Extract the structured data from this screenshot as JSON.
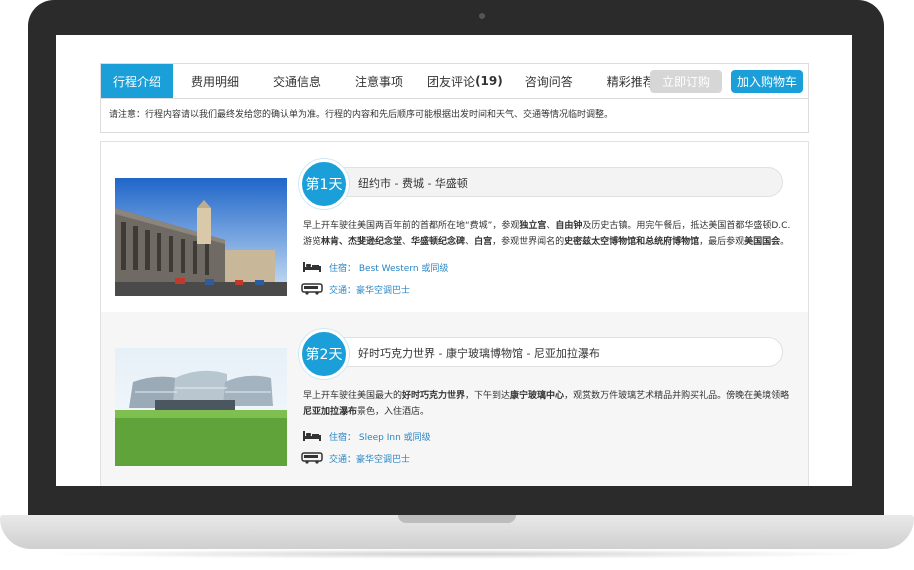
{
  "tabs": [
    {
      "label": "行程介绍"
    },
    {
      "label": "费用明细"
    },
    {
      "label": "交通信息"
    },
    {
      "label": "注意事项"
    },
    {
      "label": "团友评论",
      "count": "(19)"
    },
    {
      "label": "咨询问答"
    },
    {
      "label": "精彩推荐"
    }
  ],
  "buttons": {
    "order": "立即订购",
    "cart": "加入购物车"
  },
  "notice": "请注意：行程内容请以我们最终发给您的确认单为准。行程的内容和先后顺序可能根据出发时间和天气、交通等情况临时调整。",
  "days": [
    {
      "badge": "第1天",
      "route": "纽约市 - 费城 - 华盛顿",
      "desc_parts": [
        {
          "t": "早上开车驶往美国两百年前的首都所在地“费城”，参观",
          "b": false
        },
        {
          "t": "独立宫",
          "b": true
        },
        {
          "t": "、",
          "b": false
        },
        {
          "t": "自由钟",
          "b": true
        },
        {
          "t": "及历史古镇。用完午餐后，抵达美国首都华盛顿D.C.游览",
          "b": false
        },
        {
          "t": "林肯、杰斐逊纪念堂",
          "b": true
        },
        {
          "t": "、",
          "b": false
        },
        {
          "t": "华盛顿纪念碑",
          "b": true
        },
        {
          "t": "、",
          "b": false
        },
        {
          "t": "白宫",
          "b": true
        },
        {
          "t": "，参观世界闻名的",
          "b": false
        },
        {
          "t": "史密兹太空博物馆和总统府博物馆",
          "b": true
        },
        {
          "t": "，最后参观",
          "b": false
        },
        {
          "t": "美国国会",
          "b": true
        },
        {
          "t": "。",
          "b": false
        }
      ],
      "hotel": "住宿： Best Western 或同级",
      "transport": "交通：豪华空调巴士"
    },
    {
      "badge": "第2天",
      "route": "好时巧克力世界 - 康宁玻璃博物馆 - 尼亚加拉瀑布",
      "desc_parts": [
        {
          "t": "早上开车驶往美国最大的",
          "b": false
        },
        {
          "t": "好时巧克力世界",
          "b": true
        },
        {
          "t": "，下午到达",
          "b": false
        },
        {
          "t": "康宁玻璃中心",
          "b": true
        },
        {
          "t": "，观赏数万件玻璃艺术精品并购买礼品。傍晚在美境领略",
          "b": false
        },
        {
          "t": "尼亚加拉瀑布",
          "b": true
        },
        {
          "t": "景色，入住酒店。",
          "b": false
        }
      ],
      "hotel": "住宿： Sleep Inn 或同级",
      "transport": "交通：豪华空调巴士"
    }
  ],
  "icons": {
    "bed": "bed-icon",
    "bus": "bus-icon"
  },
  "colors": {
    "accent": "#1b9fd8",
    "link": "#2a86c4"
  }
}
